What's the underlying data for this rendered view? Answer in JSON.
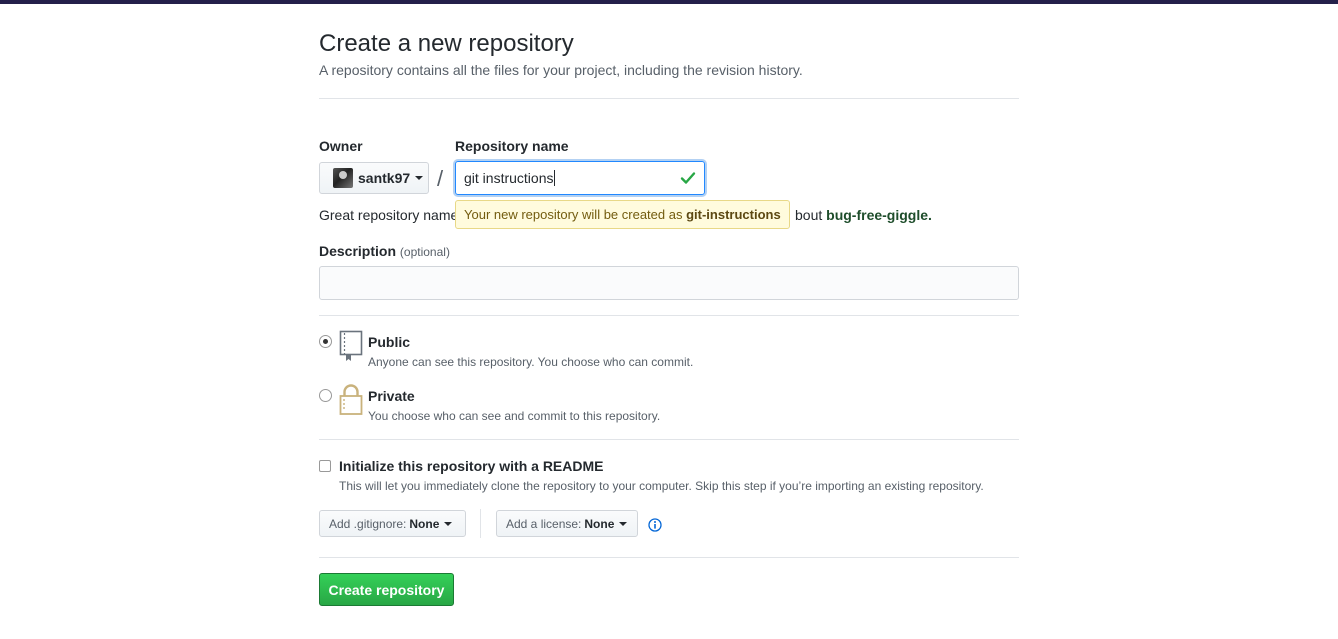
{
  "page": {
    "title": "Create a new repository",
    "subtitle": "A repository contains all the files for your project, including the revision history."
  },
  "owner": {
    "label": "Owner",
    "value": "santk97"
  },
  "separator": "/",
  "repo_name": {
    "label": "Repository name",
    "value": "git instructions"
  },
  "help": {
    "prefix": "Great repository name",
    "suffix_tail": "bout",
    "suggestion": "bug-free-giggle."
  },
  "tooltip": {
    "text": "Your new repository will be created as",
    "name": "git-instructions"
  },
  "description": {
    "label": "Description",
    "optional": "(optional)",
    "value": ""
  },
  "visibility": {
    "public_title": "Public",
    "public_note": "Anyone can see this repository. You choose who can commit.",
    "private_title": "Private",
    "private_note": "You choose who can see and commit to this repository.",
    "selected": "public"
  },
  "init": {
    "title": "Initialize this repository with a README",
    "note": "This will let you immediately clone the repository to your computer. Skip this step if you’re importing an existing repository.",
    "checked": false
  },
  "gitignore": {
    "label": "Add .gitignore:",
    "value": "None"
  },
  "license": {
    "label": "Add a license:",
    "value": "None"
  },
  "submit": {
    "label": "Create repository"
  },
  "colors": {
    "accent_green": "#28a745",
    "focus_blue": "#2188ff",
    "tooltip_bg": "#fffbdd"
  },
  "icons": [
    "caret-down-icon",
    "check-icon",
    "repo-book-icon",
    "lock-icon",
    "info-icon"
  ]
}
